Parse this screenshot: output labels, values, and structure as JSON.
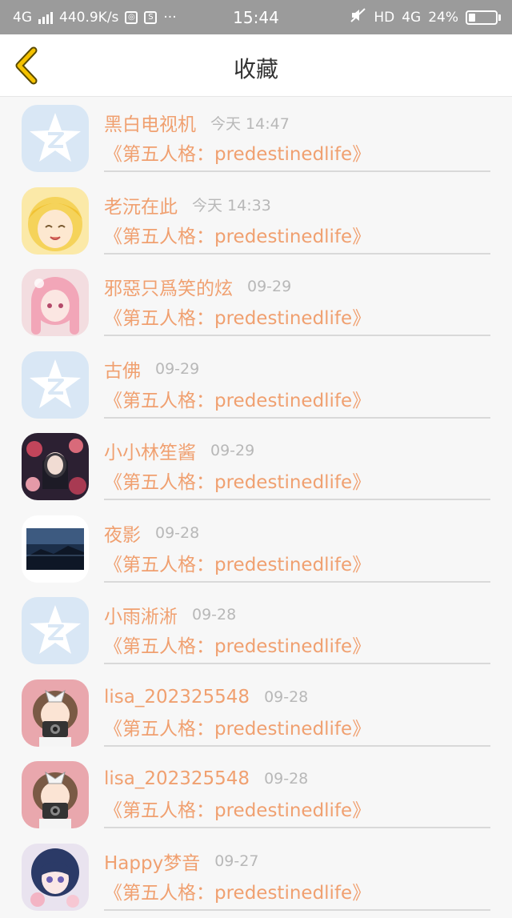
{
  "status_bar": {
    "network": "4G",
    "speed": "440.9K/s",
    "dots": "···",
    "time": "15:44",
    "hd": "HD",
    "net_type": "4G",
    "battery_percent": "24%",
    "battery_level": 0.24
  },
  "header": {
    "title": "收藏",
    "back_icon": "chevron-left-icon",
    "accent_color": "#f5c200"
  },
  "colors": {
    "name_text": "#f0a070",
    "time_text": "#b8b8b8",
    "divider": "#d9d9d9"
  },
  "items": [
    {
      "name": "黑白电视机",
      "time": "今天 14:47",
      "content": "《第五人格：predestinedlife》",
      "avatar": "qq-default-avatar"
    },
    {
      "name": "老沅在此",
      "time": "今天 14:33",
      "content": "《第五人格：predestinedlife》",
      "avatar": "anime-girl-avatar"
    },
    {
      "name": "邪惡只爲笑的炫",
      "time": "09-29",
      "content": "《第五人格：predestinedlife》",
      "avatar": "pink-hair-avatar"
    },
    {
      "name": "古佛",
      "time": "09-29",
      "content": "《第五人格：predestinedlife》",
      "avatar": "qq-default-avatar"
    },
    {
      "name": "小小林笙酱",
      "time": "09-29",
      "content": "《第五人格：predestinedlife》",
      "avatar": "dark-floral-avatar"
    },
    {
      "name": "夜影",
      "time": "09-28",
      "content": "《第五人格：predestinedlife》",
      "avatar": "night-landscape-avatar"
    },
    {
      "name": "小雨淅淅",
      "time": "09-28",
      "content": "《第五人格：predestinedlife》",
      "avatar": "qq-default-avatar"
    },
    {
      "name": "lisa_202325548",
      "time": "09-28",
      "content": "《第五人格：predestinedlife》",
      "avatar": "camera-girl-avatar"
    },
    {
      "name": "lisa_202325548",
      "time": "09-28",
      "content": "《第五人格：predestinedlife》",
      "avatar": "camera-girl-avatar"
    },
    {
      "name": "Happy梦音",
      "time": "09-27",
      "content": "《第五人格：predestinedlife》",
      "avatar": "blue-hair-avatar"
    }
  ]
}
